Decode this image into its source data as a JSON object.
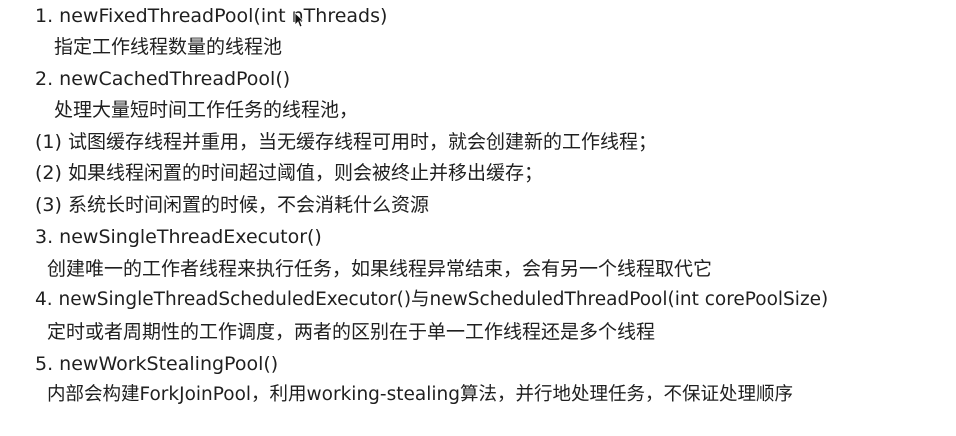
{
  "lines": [
    "1. newFixedThreadPool(int nThreads)",
    "指定工作线程数量的线程池",
    "2. newCachedThreadPool()",
    "处理大量短时间工作任务的线程池，",
    "(1) 试图缓存线程并重用，当无缓存线程可用时，就会创建新的工作线程；",
    "(2) 如果线程闲置的时间超过阈值，则会被终止并移出缓存；",
    "(3) 系统长时间闲置的时候，不会消耗什么资源",
    "3. newSingleThreadExecutor()",
    "创建唯一的工作者线程来执行任务，如果线程异常结束，会有另一个线程取代它",
    "4. newSingleThreadScheduledExecutor()与newScheduledThreadPool(int corePoolSize)",
    "定时或者周期性的工作调度，两者的区别在于单一工作线程还是多个线程",
    "5. newWorkStealingPool()",
    "内部会构建ForkJoinPool，利用working-stealing算法，并行地处理任务，不保证处理顺序"
  ]
}
